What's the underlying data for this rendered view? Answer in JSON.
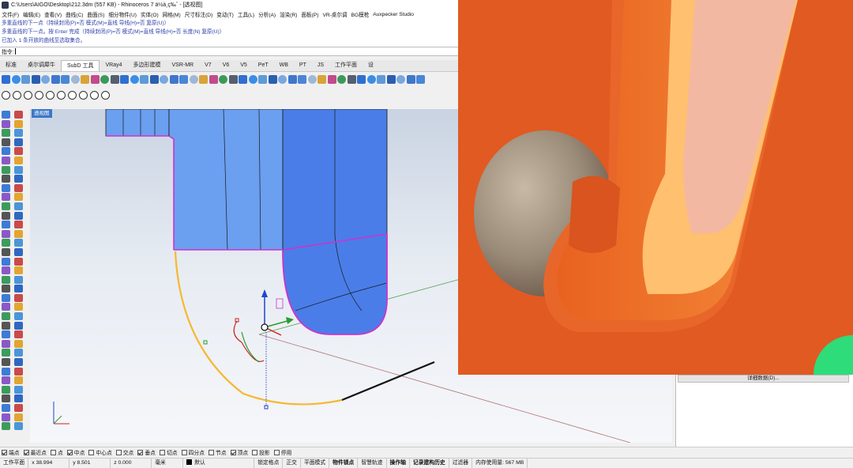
{
  "window": {
    "title": "C:\\Users\\AIGO\\Desktop\\212.3dm (557 KB) - Rhinoceros 7 ä½à¸ç‰ˆ - [透视图]",
    "icon": "rhino-app-icon"
  },
  "menu": [
    "文件(F)",
    "编辑(E)",
    "查看(V)",
    "曲线(C)",
    "曲面(S)",
    "细分物件(U)",
    "实体(O)",
    "网格(M)",
    "尺寸标注(D)",
    "变动(T)",
    "工具(L)",
    "分析(A)",
    "渲染(R)",
    "面板(P)",
    "VR-桌尔调",
    "BG模枪",
    "Auxpecker Studio"
  ],
  "command_history": [
    "多重直线的下一点（持续封闭(P)=否  模式(M)=直线  导线(H)=否  复原(U)）",
    "多重直线的下一点。按 Enter 完成（持续封闭(P)=否  模式(M)=直线  导线(H)=否  长度(N)  复原(U)）",
    "已加入 1 条开放的曲线至选取集合。"
  ],
  "command_prompt": "指令:",
  "tabs": [
    {
      "label": "标准",
      "active": false
    },
    {
      "label": "桌尔调犀牛",
      "active": false
    },
    {
      "label": "SubD 工具",
      "active": true
    },
    {
      "label": "VRay4",
      "active": false
    },
    {
      "label": "多边形建模",
      "active": false
    },
    {
      "label": "VSR-MR",
      "active": false
    },
    {
      "label": "V7",
      "active": false
    },
    {
      "label": "V6",
      "active": false
    },
    {
      "label": "V5",
      "active": false
    },
    {
      "label": "PeT",
      "active": false
    },
    {
      "label": "WB",
      "active": false
    },
    {
      "label": "PT",
      "active": false
    },
    {
      "label": "JS",
      "active": false
    },
    {
      "label": "工作平面",
      "active": false
    },
    {
      "label": "设",
      "active": false
    }
  ],
  "viewport": {
    "label": "透视图",
    "colors": {
      "surface": "#6b9ff0",
      "surface_dark": "#4a7de8",
      "edge": "#cc33cc",
      "curve": "#f5b82e",
      "line": "#111111"
    }
  },
  "right_panel": {
    "button_label": "详细数据(D)..."
  },
  "overlay": {
    "colors": {
      "background": "#e05a22",
      "arm": "#f47a2e",
      "inner": "#ffc070",
      "slot": "#f3b8a2",
      "ball": "#9a8a78",
      "corner": "#2edc7a"
    }
  },
  "snaps": [
    {
      "label": "端点",
      "checked": true
    },
    {
      "label": "最近点",
      "checked": true
    },
    {
      "label": "点",
      "checked": false
    },
    {
      "label": "中点",
      "checked": true
    },
    {
      "label": "中心点",
      "checked": false
    },
    {
      "label": "交点",
      "checked": false
    },
    {
      "label": "垂点",
      "checked": true
    },
    {
      "label": "切点",
      "checked": false
    },
    {
      "label": "四分点",
      "checked": false
    },
    {
      "label": "节点",
      "checked": false
    },
    {
      "label": "顶点",
      "checked": true
    },
    {
      "label": "投影",
      "checked": false
    },
    {
      "label": "停用",
      "checked": false
    }
  ],
  "status": {
    "cplane": "工作平面",
    "x": "x 38.994",
    "y": "y 8.501",
    "z": "z 0.000",
    "units": "毫米",
    "layer": "默认",
    "toggles": [
      "锁定格点",
      "正交",
      "平面模式",
      "物件锁点",
      "智慧轨迹",
      "操作轴",
      "记录建构历史",
      "过滤器"
    ],
    "memory": "内存使用量: 567 MB"
  }
}
